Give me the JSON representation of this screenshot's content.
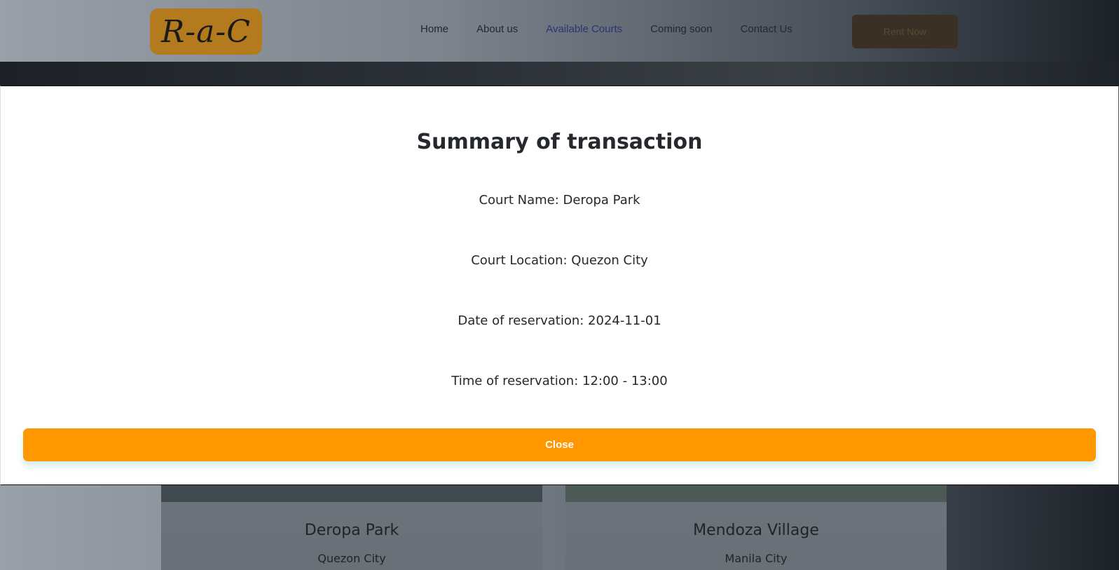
{
  "nav": {
    "logo_text": "R-a-C",
    "links": [
      "Home",
      "About us",
      "Available Courts",
      "Coming soon",
      "Contact Us"
    ],
    "active_index": 2,
    "rent_label": "Rent Now"
  },
  "modal": {
    "title": "Summary of transaction",
    "court_name": "Court Name: Deropa Park",
    "court_location": "Court Location: Quezon City",
    "date": "Date of reservation: 2024-11-01",
    "time": "Time of reservation: 12:00 - 13:00",
    "close_label": "Close"
  },
  "cards": [
    {
      "title": "Deropa Park",
      "location": "Quezon City"
    },
    {
      "title": "Mendoza Village",
      "location": "Manila City"
    }
  ],
  "colors": {
    "accent": "#fe9700",
    "active_link": "#283575",
    "logo_bg": "#b37b1d"
  }
}
